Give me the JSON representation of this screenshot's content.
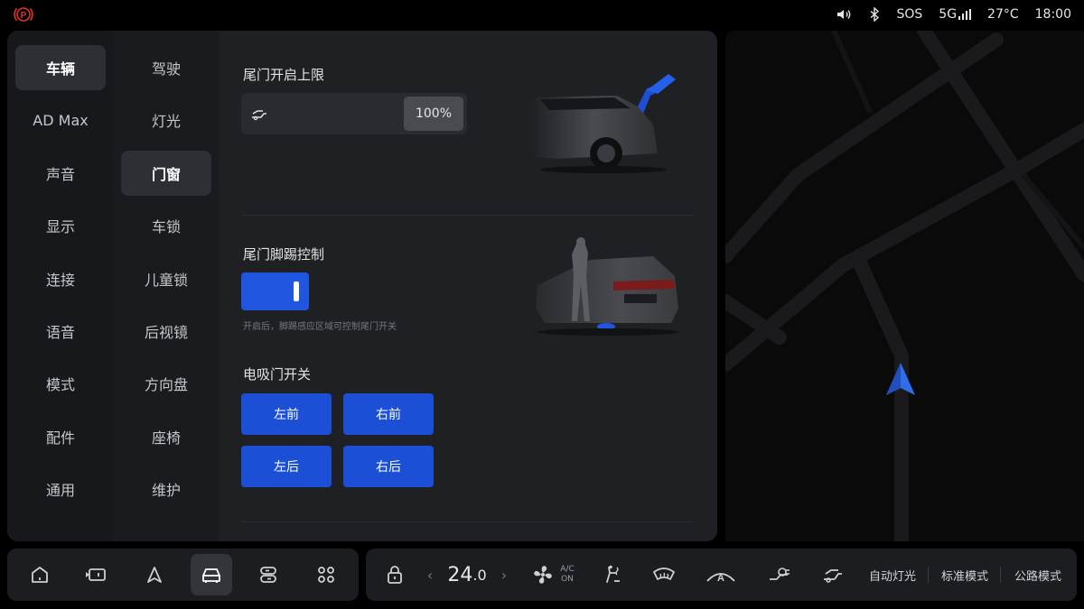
{
  "status": {
    "sos": "SOS",
    "network": "5G",
    "temperature": "27°C",
    "time": "18:00"
  },
  "nav_primary": [
    "车辆",
    "AD Max",
    "声音",
    "显示",
    "连接",
    "语音",
    "模式",
    "配件",
    "通用"
  ],
  "nav_secondary": [
    "驾驶",
    "灯光",
    "门窗",
    "车锁",
    "儿童锁",
    "后视镜",
    "方向盘",
    "座椅",
    "维护"
  ],
  "content": {
    "tailgate_limit_title": "尾门开启上限",
    "tailgate_limit_value": "100%",
    "kick_title": "尾门脚踢控制",
    "kick_enabled": true,
    "kick_hint": "开启后，脚踢感应区域可控制尾门开关",
    "electric_door_title": "电吸门开关",
    "doors": [
      "左前",
      "右前",
      "左后",
      "右后"
    ]
  },
  "climate": {
    "temperature": "24",
    "temperature_decimal": ".0",
    "ac_label_top": "A/C",
    "ac_label_bottom": "ON"
  },
  "modes": [
    "自动灯光",
    "标准模式",
    "公路模式"
  ],
  "colors": {
    "accent": "#1a4fd6",
    "toggle_on": "#1f55e0",
    "park_brake": "#e0342b",
    "nav_arrow": "#2f6ee8"
  }
}
